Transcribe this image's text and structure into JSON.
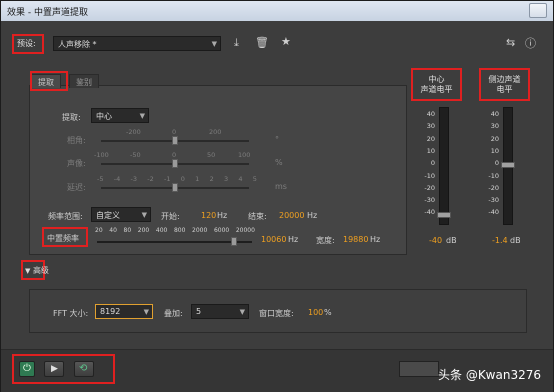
{
  "window": {
    "title": "效果 - 中置声道提取"
  },
  "preset": {
    "label": "预设:",
    "value": "人声移除 *"
  },
  "tabs": [
    {
      "label": "提取"
    },
    {
      "label": "鉴别"
    }
  ],
  "extract": {
    "label": "提取:",
    "value": "中心"
  },
  "angle": {
    "label": "相角:",
    "ticks": [
      "-200",
      "0",
      "200"
    ],
    "unit": "°"
  },
  "pan": {
    "label": "声像:",
    "ticks": [
      "-100",
      "-50",
      "0",
      "50",
      "100"
    ],
    "unit": "%"
  },
  "delay": {
    "label": "延迟:",
    "ticks": [
      "-5",
      "-4",
      "-3",
      "-2",
      "-1",
      "0",
      "1",
      "2",
      "3",
      "4",
      "5"
    ],
    "unit": "ms"
  },
  "freq_range": {
    "label": "频率范围:",
    "value": "自定义",
    "start_label": "开始:",
    "start_value": "120",
    "start_unit": "Hz",
    "end_label": "结束:",
    "end_value": "20000",
    "end_unit": "Hz"
  },
  "center_freq": {
    "label": "中置频率",
    "ticks": [
      "20",
      "40",
      "80",
      "200",
      "400",
      "800",
      "2000",
      "6000",
      "20000"
    ],
    "value": "10060",
    "unit": "Hz",
    "width_label": "宽度:",
    "width_value": "19880",
    "width_unit": "Hz"
  },
  "center_level": {
    "label": "中心\n声道电平",
    "value": "-40",
    "unit": "dB",
    "level_db": -40
  },
  "side_level": {
    "label": "侧边声道\n电平",
    "value": "-1.4",
    "unit": "dB",
    "level_db": -1.4
  },
  "meter_scale": [
    "40",
    "30",
    "20",
    "10",
    "0",
    "-10",
    "-20",
    "-30",
    "-40"
  ],
  "advanced": {
    "label": "高级"
  },
  "fft": {
    "label": "FFT 大小:",
    "value": "8192"
  },
  "overlap": {
    "label": "叠加:",
    "value": "5"
  },
  "window_width": {
    "label": "窗口宽度:",
    "value": "100",
    "unit": "%"
  },
  "watermark": {
    "text": "头条 @Kwan3276"
  }
}
